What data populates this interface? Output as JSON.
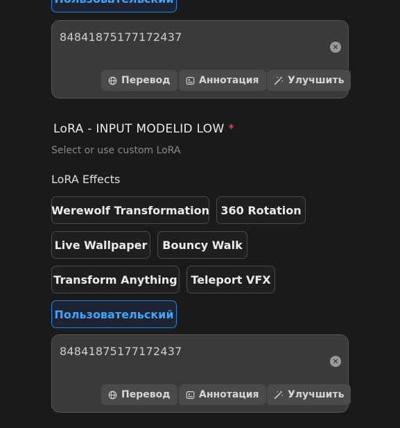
{
  "top_section": {
    "custom_chip_label": "Пользовательский",
    "prompt_value": "84841875177172437",
    "translate_label": "Перевод",
    "annotate_label": "Аннотация",
    "improve_label": "Улучшить",
    "clear_symbol": "×"
  },
  "lora_section": {
    "title": "LoRA - INPUT MODELID LOW",
    "required_mark": "*",
    "subtitle": "Select or use custom LoRA",
    "effects_label": "LoRA Effects",
    "effects": [
      "Werewolf Transformation",
      "360 Rotation",
      "Live Wallpaper",
      "Bouncy Walk",
      "Transform Anything",
      "Teleport VFX"
    ],
    "custom_chip_label": "Пользовательский",
    "prompt_value": "84841875177172437",
    "translate_label": "Перевод",
    "annotate_label": "Аннотация",
    "improve_label": "Улучшить",
    "clear_symbol": "×"
  },
  "icons": {
    "translate": "globe-icon",
    "annotate": "image-caption-icon",
    "improve": "magic-wand-icon",
    "clear": "close-circle-icon"
  },
  "colors": {
    "background": "#1a1a1a",
    "accent": "#3ea6ff",
    "accent_border": "#1e88e5",
    "required": "#ff5252"
  }
}
